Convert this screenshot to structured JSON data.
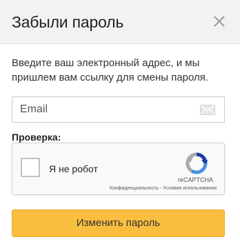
{
  "dialog": {
    "title": "Забыли пароль",
    "close_icon": "close-icon",
    "intro_text": "Введите ваш электронный адрес, и мы пришлем вам ссылку для смены пароля."
  },
  "email": {
    "placeholder": "Email",
    "value": "",
    "icon": "envelope-icon"
  },
  "captcha": {
    "label": "Проверка:",
    "checkbox_text": "Я не робот",
    "checked": false,
    "brand": "reCAPTCHA",
    "privacy_link": "Конфиденциальность",
    "separator": " - ",
    "terms_link": "Условия использования"
  },
  "submit": {
    "label": "Изменить пароль"
  },
  "colors": {
    "header_bg": "#f2f2f2",
    "button_bg": "#f9be3f",
    "recaptcha_blue": "#4a90e2"
  }
}
